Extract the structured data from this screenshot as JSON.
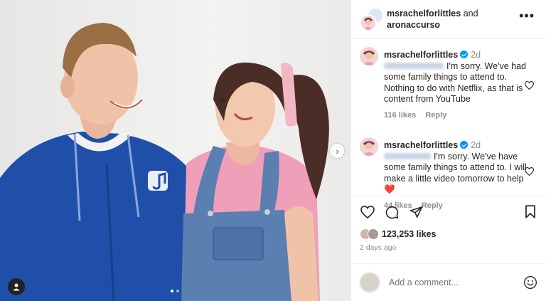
{
  "header": {
    "user1": "msrachelforlittles",
    "joiner": "and",
    "user2": "aronaccurso"
  },
  "comments": [
    {
      "username": "msrachelforlittles",
      "verified": true,
      "time": "2d",
      "text": "I'm sorry. We've had some family things to attend to. Nothing to do with Netflix, as that is content from YouTube",
      "likes_label": "116 likes",
      "reply_label": "Reply"
    },
    {
      "username": "msrachelforlittles",
      "verified": true,
      "time": "2d",
      "text": "I'm sorry. We've have some family things to attend to. I will make a little video tomorrow to help ❤️",
      "likes_label": "44 likes",
      "reply_label": "Reply"
    }
  ],
  "icons": {
    "like": "heart-icon",
    "comment": "comment-icon",
    "share": "share-icon",
    "save": "bookmark-icon",
    "more": "more-icon",
    "next": "chevron-right-icon",
    "tag": "user-tag-icon",
    "emoji": "emoji-icon"
  },
  "likes": {
    "count": "123,253 likes"
  },
  "timestamp": "2 days ago",
  "comment_box": {
    "placeholder": "Add a comment..."
  },
  "carousel": {
    "total": 2,
    "active": 1
  },
  "colors": {
    "verified": "#0095f6",
    "hoodie": "#1f4fa8",
    "shirt": "#ef9fb8",
    "overalls": "#5b7fb0",
    "text_muted": "#8e8e8e"
  }
}
